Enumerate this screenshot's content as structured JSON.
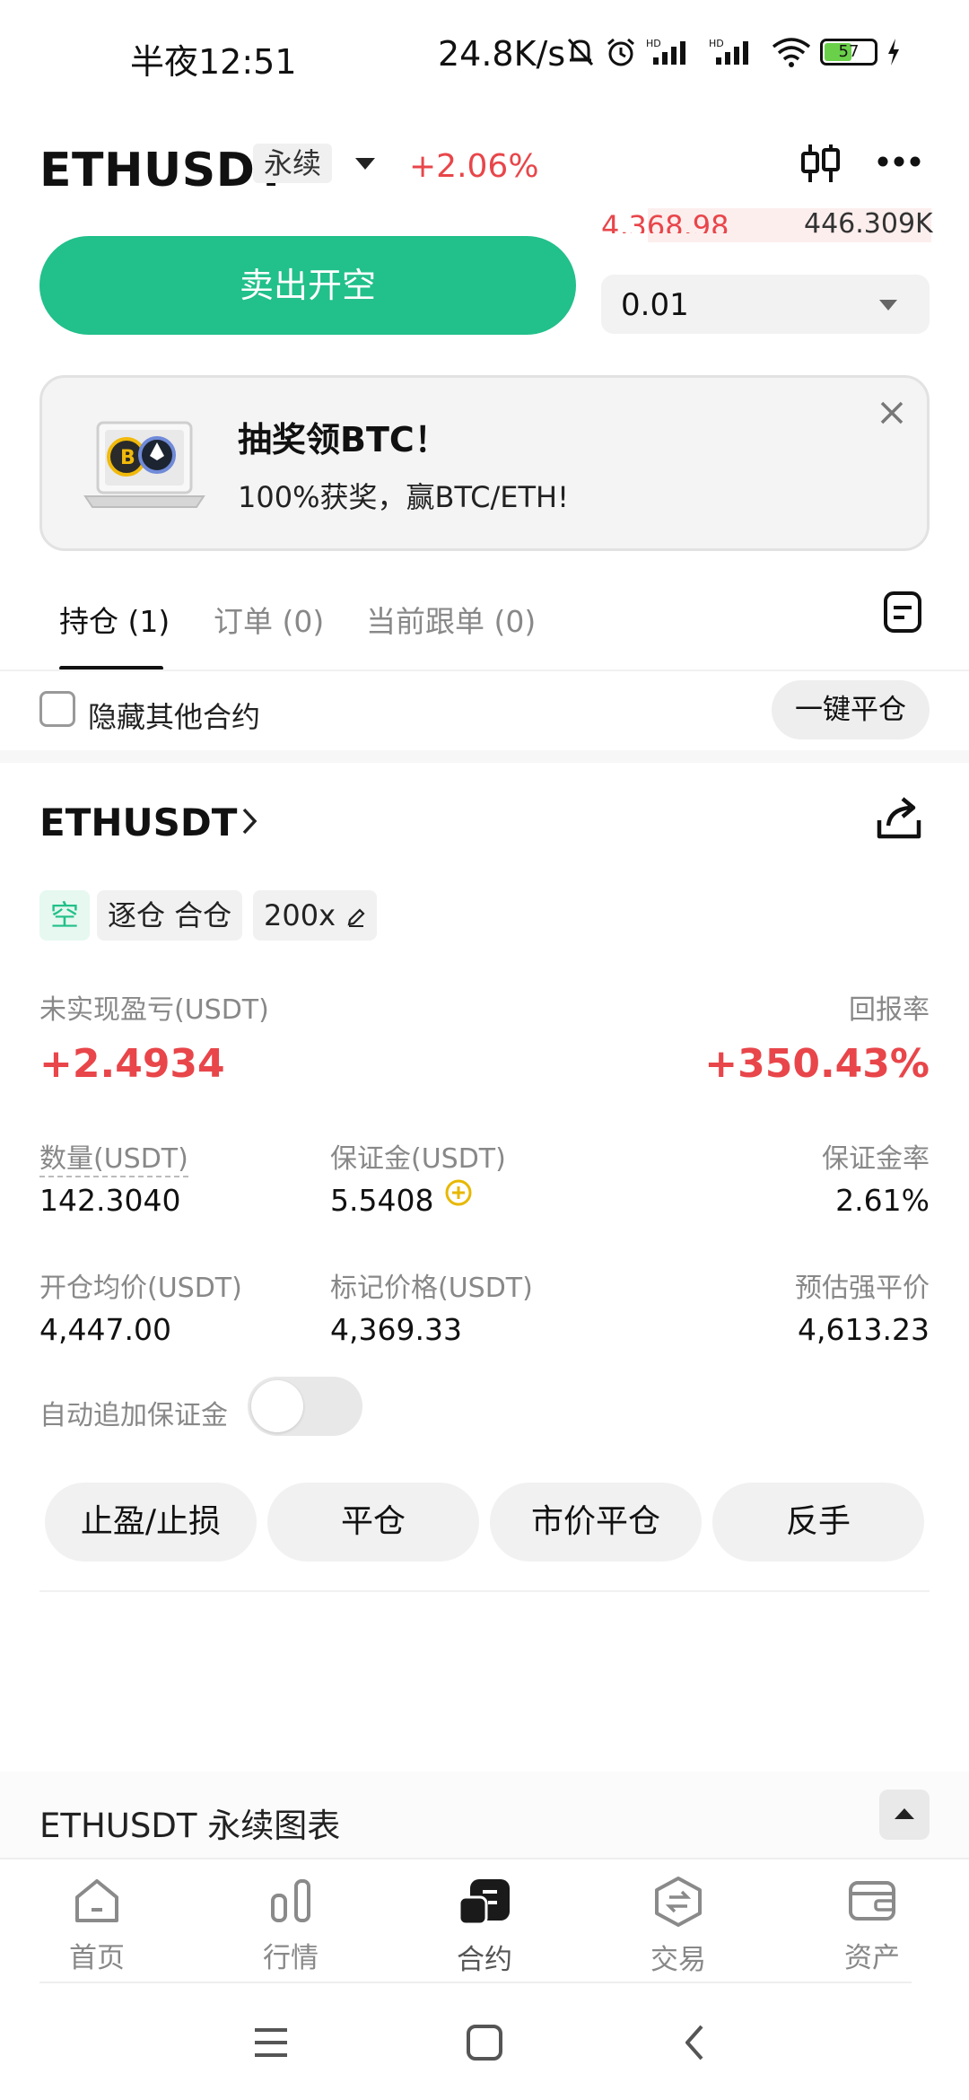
{
  "status_bar": {
    "time": "半夜12:51",
    "network_speed": "24.8K/s",
    "battery": "57"
  },
  "header": {
    "symbol": "ETHUSDT",
    "contract_type": "永续",
    "change_pct": "+2.06%"
  },
  "order_book": {
    "price": "4,368.98",
    "volume": "446.309K"
  },
  "trade": {
    "sell_label": "卖出开空",
    "quantity": "0.01"
  },
  "banner": {
    "title": "抽奖领BTC！",
    "subtitle": "100%获奖，赢BTC/ETH!"
  },
  "tabs": [
    {
      "label": "持仓 (1)"
    },
    {
      "label": "订单 (0)"
    },
    {
      "label": "当前跟单 (0)"
    }
  ],
  "filter": {
    "hide_label": "隐藏其他合约",
    "close_all_label": "一键平仓"
  },
  "position": {
    "symbol": "ETHUSDT",
    "side": "空",
    "margin_mode": "逐仓 合仓",
    "leverage": "200x",
    "unrealized_pnl_label": "未实现盈亏(USDT)",
    "unrealized_pnl": "+2.4934",
    "roe_label": "回报率",
    "roe": "+350.43%",
    "quantity_label": "数量(USDT)",
    "quantity": "142.3040",
    "margin_label": "保证金(USDT)",
    "margin": "5.5408",
    "margin_ratio_label": "保证金率",
    "margin_ratio": "2.61%",
    "entry_price_label": "开仓均价(USDT)",
    "entry_price": "4,447.00",
    "mark_price_label": "标记价格(USDT)",
    "mark_price": "4,369.33",
    "liq_price_label": "预估强平价",
    "liq_price": "4,613.23",
    "auto_margin_label": "自动追加保证金",
    "auto_margin_on": false
  },
  "actions": {
    "tp_sl": "止盈/止损",
    "close": "平仓",
    "market_close": "市价平仓",
    "reverse": "反手"
  },
  "chart_section": {
    "title": "ETHUSDT 永续图表"
  },
  "nav": [
    {
      "label": "首页",
      "icon": "home-icon"
    },
    {
      "label": "行情",
      "icon": "market-icon"
    },
    {
      "label": "合约",
      "icon": "contract-icon",
      "active": true
    },
    {
      "label": "交易",
      "icon": "trade-icon"
    },
    {
      "label": "资产",
      "icon": "wallet-icon"
    }
  ],
  "colors": {
    "buy_green": "#22c08a",
    "sell_red": "#e8464a"
  }
}
